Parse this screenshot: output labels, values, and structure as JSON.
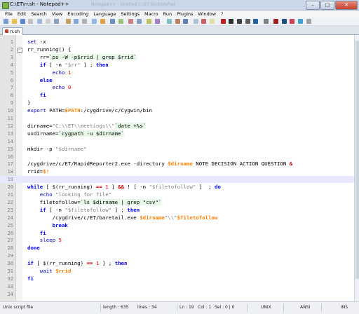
{
  "window": {
    "title": "C:\\ET\\rr.sh - Notepad++",
    "ghost_title": "Notepad++ - Untitled     C:\\ET   ScribblePad"
  },
  "menu": [
    "File",
    "Edit",
    "Search",
    "View",
    "Encoding",
    "Language",
    "Settings",
    "Macro",
    "Run",
    "Plugins",
    "Window",
    "?"
  ],
  "tab": {
    "label": "rr.sh"
  },
  "status": {
    "filetype": "Unix script file",
    "length": "length : 635",
    "lines": "lines : 34",
    "ln": "Ln : 19",
    "col": "Col : 1",
    "sel": "Sel : 0 | 0",
    "eol": "UNIX",
    "encoding": "ANSI",
    "mode": "INS"
  },
  "editor": {
    "current_line": 19,
    "lines": [
      {
        "n": "1",
        "fold": "",
        "tokens": [
          [
            "cm",
            "set "
          ],
          [
            "plain",
            "-x"
          ]
        ]
      },
      {
        "n": "2",
        "fold": "-",
        "tokens": [
          [
            "plain",
            "rr_running() {"
          ]
        ]
      },
      {
        "n": "3",
        "fold": "",
        "tokens": [
          [
            "plain",
            "    rr="
          ],
          [
            "bt",
            "`ps -W -p$rrid | grep $rrid`"
          ]
        ]
      },
      {
        "n": "4",
        "fold": "",
        "tokens": [
          [
            "kw",
            "    if "
          ],
          [
            "plain",
            "[ -n "
          ],
          [
            "str",
            "\"$rr\""
          ],
          [
            "plain",
            " ] ; "
          ],
          [
            "kw",
            "then"
          ]
        ]
      },
      {
        "n": "5",
        "fold": "",
        "tokens": [
          [
            "cm",
            "        echo "
          ],
          [
            "num",
            "1"
          ]
        ]
      },
      {
        "n": "6",
        "fold": "",
        "tokens": [
          [
            "kw",
            "    else"
          ]
        ]
      },
      {
        "n": "7",
        "fold": "",
        "tokens": [
          [
            "cm",
            "        echo "
          ],
          [
            "num",
            "0"
          ]
        ]
      },
      {
        "n": "8",
        "fold": "",
        "tokens": [
          [
            "kw",
            "    fi"
          ]
        ]
      },
      {
        "n": "9",
        "fold": "",
        "tokens": [
          [
            "plain",
            "}"
          ]
        ]
      },
      {
        "n": "10",
        "fold": "",
        "tokens": [
          [
            "cm",
            "export "
          ],
          [
            "plain",
            "PATH="
          ],
          [
            "var",
            "$PATH"
          ],
          [
            "plain",
            ":/cygdrive/c/Cygwin/bin"
          ]
        ]
      },
      {
        "n": "11",
        "fold": "",
        "tokens": [
          [
            "plain",
            ""
          ]
        ]
      },
      {
        "n": "12",
        "fold": "",
        "tokens": [
          [
            "plain",
            "dirname="
          ],
          [
            "str",
            "\"C:\\\\ET\\\\meetings\\\\\""
          ],
          [
            "bt",
            "`date +%s`"
          ]
        ]
      },
      {
        "n": "13",
        "fold": "",
        "tokens": [
          [
            "plain",
            "uxdirname="
          ],
          [
            "bt",
            "`cygpath -u $dirname`"
          ]
        ]
      },
      {
        "n": "14",
        "fold": "",
        "tokens": [
          [
            "plain",
            ""
          ]
        ]
      },
      {
        "n": "15",
        "fold": "",
        "tokens": [
          [
            "plain",
            "mkdir -p "
          ],
          [
            "str",
            "\"$dirname\""
          ]
        ]
      },
      {
        "n": "16",
        "fold": "",
        "tokens": [
          [
            "plain",
            ""
          ]
        ]
      },
      {
        "n": "17",
        "fold": "",
        "tokens": [
          [
            "plain",
            "/cygdrive/c/ET/RapidReporter2.exe -directory "
          ],
          [
            "var",
            "$dirname"
          ],
          [
            "plain",
            " NOTE DECISION ACTION QUESTION "
          ],
          [
            "op",
            "&"
          ]
        ]
      },
      {
        "n": "18",
        "fold": "",
        "tokens": [
          [
            "plain",
            "rrid="
          ],
          [
            "var",
            "$!"
          ]
        ]
      },
      {
        "n": "19",
        "fold": "",
        "tokens": [
          [
            "plain",
            ""
          ]
        ]
      },
      {
        "n": "20",
        "fold": "",
        "tokens": [
          [
            "kw",
            "while "
          ],
          [
            "plain",
            "[ $(rr_running) "
          ],
          [
            "op",
            "=="
          ],
          [
            "plain",
            " "
          ],
          [
            "num",
            "1"
          ],
          [
            "plain",
            " ] "
          ],
          [
            "op",
            "&&"
          ],
          [
            "plain",
            " ! [ -n "
          ],
          [
            "str",
            "\"$filetofollow\""
          ],
          [
            "plain",
            " ]  ; "
          ],
          [
            "kw",
            "do"
          ]
        ]
      },
      {
        "n": "21",
        "fold": "",
        "tokens": [
          [
            "cm",
            "    echo "
          ],
          [
            "str",
            "\"looking for file\""
          ]
        ]
      },
      {
        "n": "22",
        "fold": "",
        "tokens": [
          [
            "plain",
            "    filetofollow="
          ],
          [
            "bt",
            "`ls $dirname | grep \"csv\"`"
          ]
        ]
      },
      {
        "n": "23",
        "fold": "",
        "tokens": [
          [
            "kw",
            "    if "
          ],
          [
            "plain",
            "[ -n "
          ],
          [
            "str",
            "\"$filetofollow\""
          ],
          [
            "plain",
            " ] ; "
          ],
          [
            "kw",
            "then"
          ]
        ]
      },
      {
        "n": "24",
        "fold": "",
        "tokens": [
          [
            "plain",
            "        /cygdrive/c/ET/baretail.exe "
          ],
          [
            "var",
            "$dirname"
          ],
          [
            "str",
            "\"\\\\\""
          ],
          [
            "var",
            "$filetofollow"
          ]
        ]
      },
      {
        "n": "25",
        "fold": "",
        "tokens": [
          [
            "kw",
            "        break"
          ]
        ]
      },
      {
        "n": "26",
        "fold": "",
        "tokens": [
          [
            "kw",
            "    fi"
          ]
        ]
      },
      {
        "n": "27",
        "fold": "",
        "tokens": [
          [
            "cm",
            "    sleep "
          ],
          [
            "num",
            "5"
          ]
        ]
      },
      {
        "n": "28",
        "fold": "",
        "tokens": [
          [
            "kw",
            "done"
          ]
        ]
      },
      {
        "n": "29",
        "fold": "",
        "tokens": [
          [
            "plain",
            ""
          ]
        ]
      },
      {
        "n": "30",
        "fold": "",
        "tokens": [
          [
            "kw",
            "if "
          ],
          [
            "plain",
            "[ $(rr_running) "
          ],
          [
            "op",
            "=="
          ],
          [
            "plain",
            " "
          ],
          [
            "num",
            "1"
          ],
          [
            "plain",
            " ] ; "
          ],
          [
            "kw",
            "then"
          ]
        ]
      },
      {
        "n": "31",
        "fold": "",
        "tokens": [
          [
            "cm",
            "    wait "
          ],
          [
            "var",
            "$rrid"
          ]
        ]
      },
      {
        "n": "32",
        "fold": "",
        "tokens": [
          [
            "kw",
            "fi"
          ]
        ]
      },
      {
        "n": "33",
        "fold": "",
        "tokens": [
          [
            "plain",
            ""
          ]
        ]
      },
      {
        "n": "34",
        "fold": "",
        "tokens": [
          [
            "plain",
            ""
          ]
        ]
      }
    ]
  },
  "colors": {
    "keyword": "#0000ff",
    "command": "#0000c0",
    "string": "#808080",
    "number": "#ff0000",
    "variable": "#ff8000",
    "operator": "#d40000",
    "current_line_bg": "#e8e8ff"
  }
}
